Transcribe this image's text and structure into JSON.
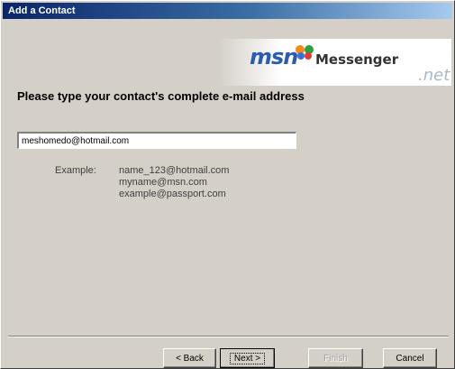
{
  "window": {
    "title": "Add a Contact"
  },
  "logo": {
    "brand": "msn",
    "product": "Messenger",
    "suffix": ".net"
  },
  "main": {
    "heading": "Please type your contact's complete e-mail address",
    "email_value": "meshomedo@hotmail.com",
    "example_label": "Example:",
    "examples": [
      "name_123@hotmail.com",
      "myname@msn.com",
      "example@passport.com"
    ]
  },
  "buttons": {
    "back": "< Back",
    "next": "Next >",
    "finish": "Finish",
    "cancel": "Cancel"
  },
  "colors": {
    "titlebar_start": "#0a246a",
    "titlebar_end": "#a6caf0",
    "dialog_bg": "#d4d0c8",
    "msn_blue": "#2a5db0"
  }
}
